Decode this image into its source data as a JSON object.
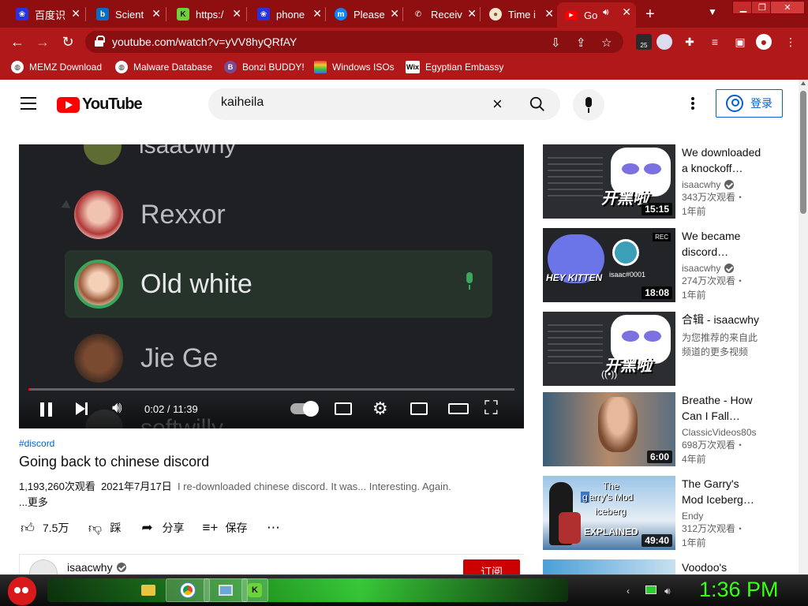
{
  "tabs": [
    {
      "title": "百度识",
      "icon": "baidu-icon",
      "color": "#2932e1"
    },
    {
      "title": "Scient",
      "icon": "bing-icon",
      "color": "#0a6dc4"
    },
    {
      "title": "https:/",
      "icon": "kook-icon",
      "color": "#6cd43a"
    },
    {
      "title": "phone",
      "icon": "baidu-icon",
      "color": "#2932e1"
    },
    {
      "title": "Please",
      "icon": "messenger-icon",
      "color": "#0a84ff"
    },
    {
      "title": "Receiv",
      "icon": "phone-icon",
      "color": "#ffffff"
    },
    {
      "title": "Time i",
      "icon": "cookie-icon",
      "color": "#ffffff"
    },
    {
      "title": "Go",
      "icon": "youtube-icon",
      "color": "#ff0000"
    }
  ],
  "address": {
    "url": "youtube.com/watch?v=yVV8hyQRfAY"
  },
  "extension_badge": "25",
  "bookmarks": [
    {
      "label": "MEMZ Download"
    },
    {
      "label": "Malware Database"
    },
    {
      "label": "Bonzi BUDDY!"
    },
    {
      "label": "Windows ISOs"
    },
    {
      "label": "Egyptian Embassy"
    }
  ],
  "header": {
    "logo_text": "YouTube",
    "search_value": "kaiheila",
    "signin_label": "登录"
  },
  "player": {
    "members": [
      "isaacwhy",
      "Rexxor",
      "Old white",
      "Jie Ge",
      "softwilly"
    ],
    "time_current": "0:02",
    "time_total": "11:39",
    "progress_fraction": 0.003
  },
  "video": {
    "hashtag": "#discord",
    "title": "Going back to chinese discord",
    "views": "1,193,260次观看",
    "date": "2021年7月17日",
    "description": "I re-downloaded chinese discord. It was... Interesting. Again.",
    "more": "...更多",
    "likes": "7.5万",
    "dislike_label": "踩",
    "share_label": "分享",
    "save_label": "保存",
    "channel": "isaacwhy",
    "subscribe_label": "订阅"
  },
  "recommendations": [
    {
      "title_1": "We downloaded",
      "title_2": "a knockoff…",
      "channel": "isaacwhy",
      "verified": true,
      "views": "343万次观看・",
      "age": "1年前",
      "duration": "15:15"
    },
    {
      "title_1": "We became",
      "title_2": "discord…",
      "channel": "isaacwhy",
      "verified": true,
      "views": "274万次观看・",
      "age": "1年前",
      "duration": "18:08"
    },
    {
      "title_1": "合辑 - isaacwhy",
      "title_2": "",
      "channel": "为您推荐的来自此",
      "verified": false,
      "views": "频道的更多视频",
      "age": "",
      "duration": ""
    },
    {
      "title_1": "Breathe - How",
      "title_2": "Can I Fall…",
      "channel": "ClassicVideos80s",
      "verified": false,
      "views": "698万次观看・",
      "age": "4年前",
      "duration": "6:00"
    },
    {
      "title_1": "The Garry's",
      "title_2": "Mod Iceberg…",
      "channel": "Endy",
      "verified": false,
      "views": "312万次观看・",
      "age": "1年前",
      "duration": "49:40"
    },
    {
      "title_1": "Voodoo's",
      "title_2": "",
      "channel": "",
      "verified": false,
      "views": "",
      "age": "",
      "duration": ""
    }
  ],
  "thumb_text": {
    "kaiheila_cn": "开黑啦",
    "hey_kitten": "HEY KITTEN",
    "isaac_tag": "isaac#0001",
    "rec": "REC",
    "the": "The",
    "garrys": "arry's Mod",
    "iceberg": "iceberg",
    "explained": "EXPLAINED"
  },
  "taskbar": {
    "clock": "1:36 PM"
  }
}
